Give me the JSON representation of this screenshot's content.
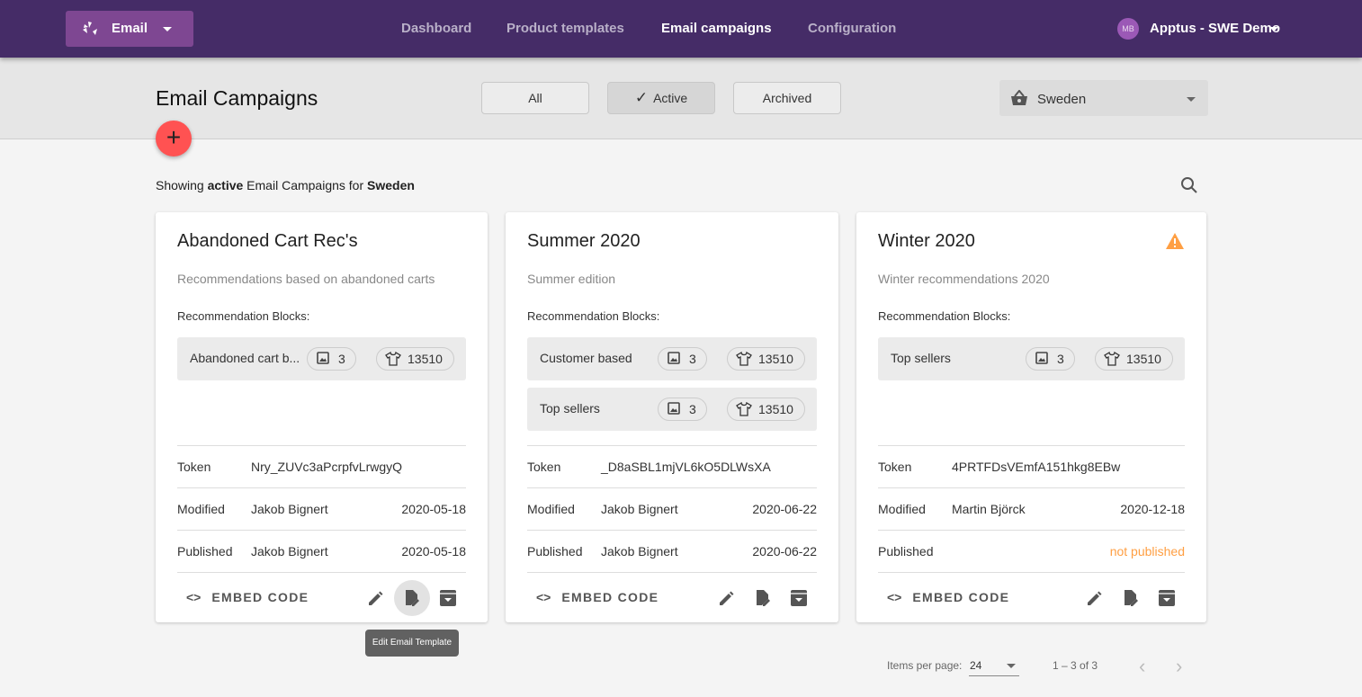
{
  "topbar": {
    "app_label": "Email",
    "nav": [
      "Dashboard",
      "Product templates",
      "Email campaigns",
      "Configuration"
    ],
    "active_nav": "Email campaigns",
    "avatar_initials": "MB",
    "account": "Apptus - SWE Demo",
    "color": "#452c67"
  },
  "header": {
    "title": "Email Campaigns",
    "filters": [
      "All",
      "Active",
      "Archived"
    ],
    "selected_filter": "Active",
    "country": "Sweden",
    "add_icon": "plus-icon"
  },
  "summary": {
    "prefix": "Showing ",
    "status": "active",
    "middle": " Email Campaigns for ",
    "country": "Sweden"
  },
  "labels": {
    "recommendation_blocks": "Recommendation Blocks:",
    "token": "Token",
    "modified": "Modified",
    "published": "Published",
    "embed_code": "EMBED CODE"
  },
  "campaigns": [
    {
      "title": "Abandoned Cart Rec's",
      "description": "Recommendations based on abandoned carts",
      "warning": false,
      "blocks": [
        {
          "name": "Abandoned cart b...",
          "images": "3",
          "products": "13510"
        }
      ],
      "token": "Nry_ZUVc3aPcrpfvLrwgyQ",
      "modified_by": "Jakob Bignert",
      "modified_date": "2020-05-18",
      "published_by": "Jakob Bignert",
      "published_date": "2020-05-18"
    },
    {
      "title": "Summer 2020",
      "description": "Summer edition",
      "warning": false,
      "blocks": [
        {
          "name": "Customer based",
          "images": "3",
          "products": "13510"
        },
        {
          "name": "Top sellers",
          "images": "3",
          "products": "13510"
        }
      ],
      "token": "_D8aSBL1mjVL6kO5DLWsXA",
      "modified_by": "Jakob Bignert",
      "modified_date": "2020-06-22",
      "published_by": "Jakob Bignert",
      "published_date": "2020-06-22"
    },
    {
      "title": "Winter 2020",
      "description": "Winter recommendations 2020",
      "warning": true,
      "blocks": [
        {
          "name": "Top sellers",
          "images": "3",
          "products": "13510"
        }
      ],
      "token": "4PRTFDsVEmfA151hkg8EBw",
      "modified_by": "Martin Björck",
      "modified_date": "2020-12-18",
      "published_by": "",
      "published_date": "not published"
    }
  ],
  "tooltip": "Edit Email Template",
  "pagination": {
    "items_per_page_label": "Items per page:",
    "items_per_page": "24",
    "range": "1 – 3 of 3"
  }
}
